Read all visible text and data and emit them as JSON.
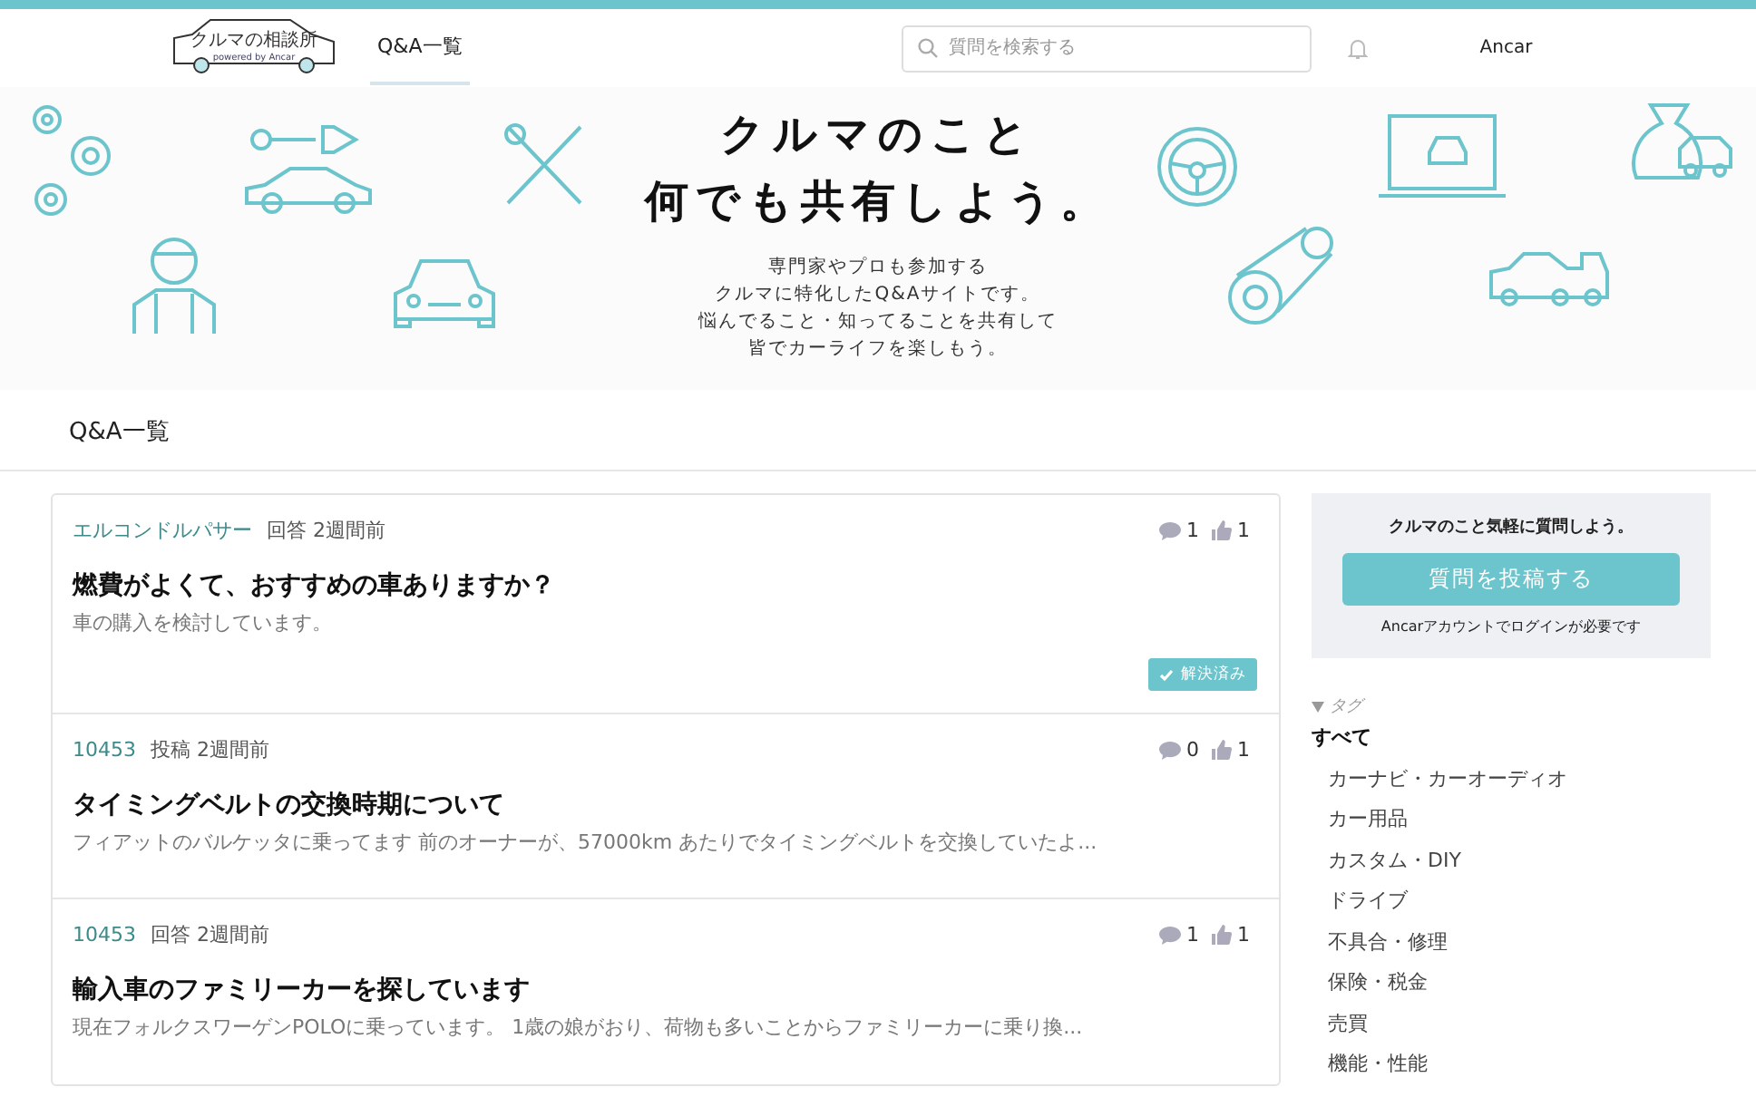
{
  "header": {
    "logo": {
      "title": "クルマの相談所",
      "powered": "powered by Ancar"
    },
    "nav": [
      {
        "label": "Q&A一覧",
        "selected": true
      }
    ],
    "search": {
      "placeholder": "質問を検索する"
    },
    "user": "Ancar"
  },
  "hero": {
    "headline": [
      "クルマのこと",
      "何でも共有しよう。"
    ],
    "lines": [
      "専門家やプロも参加する",
      "クルマに特化したQ&Aサイトです。",
      "悩んでること・知ってることを共有して",
      "皆でカーライフを楽しもう。"
    ]
  },
  "section_title": "Q&A一覧",
  "questions": [
    {
      "author": "エルコンドルパサー",
      "meta": "回答 2週間前",
      "comments": "1",
      "likes": "1",
      "title": "燃費がよくて、おすすめの車ありますか？",
      "excerpt": "車の購入を検討しています。",
      "solved": true,
      "badge": "解決済み"
    },
    {
      "author": "10453",
      "meta": "投稿 2週間前",
      "comments": "0",
      "likes": "1",
      "title": "タイミングベルトの交換時期について",
      "excerpt": "フィアットのバルケッタに乗ってます 前のオーナーが、57000km あたりでタイミングベルトを交換していたよ...",
      "solved": false
    },
    {
      "author": "10453",
      "meta": "回答 2週間前",
      "comments": "1",
      "likes": "1",
      "title": "輸入車のファミリーカーを探しています",
      "excerpt": "現在フォルクスワーゲンPOLOに乗っています。 1歳の娘がおり、荷物も多いことからファミリーカーに乗り換...",
      "solved": false
    }
  ],
  "sidebar": {
    "prompt": "クルマのこと気軽に質問しよう。",
    "button": "質問を投稿する",
    "note": "Ancarアカウントでログインが必要です",
    "tags_header": {
      "label": "タグ",
      "expanded": true
    },
    "tags": [
      {
        "label": "すべて",
        "selected": true
      },
      {
        "label": "カーナビ・カーオーディオ",
        "selected": false
      },
      {
        "label": "カー用品",
        "selected": false
      },
      {
        "label": "カスタム・DIY",
        "selected": false
      },
      {
        "label": "ドライブ",
        "selected": false
      },
      {
        "label": "不具合・修理",
        "selected": false
      },
      {
        "label": "保険・税金",
        "selected": false
      },
      {
        "label": "売買",
        "selected": false
      },
      {
        "label": "機能・性能",
        "selected": false
      }
    ]
  }
}
